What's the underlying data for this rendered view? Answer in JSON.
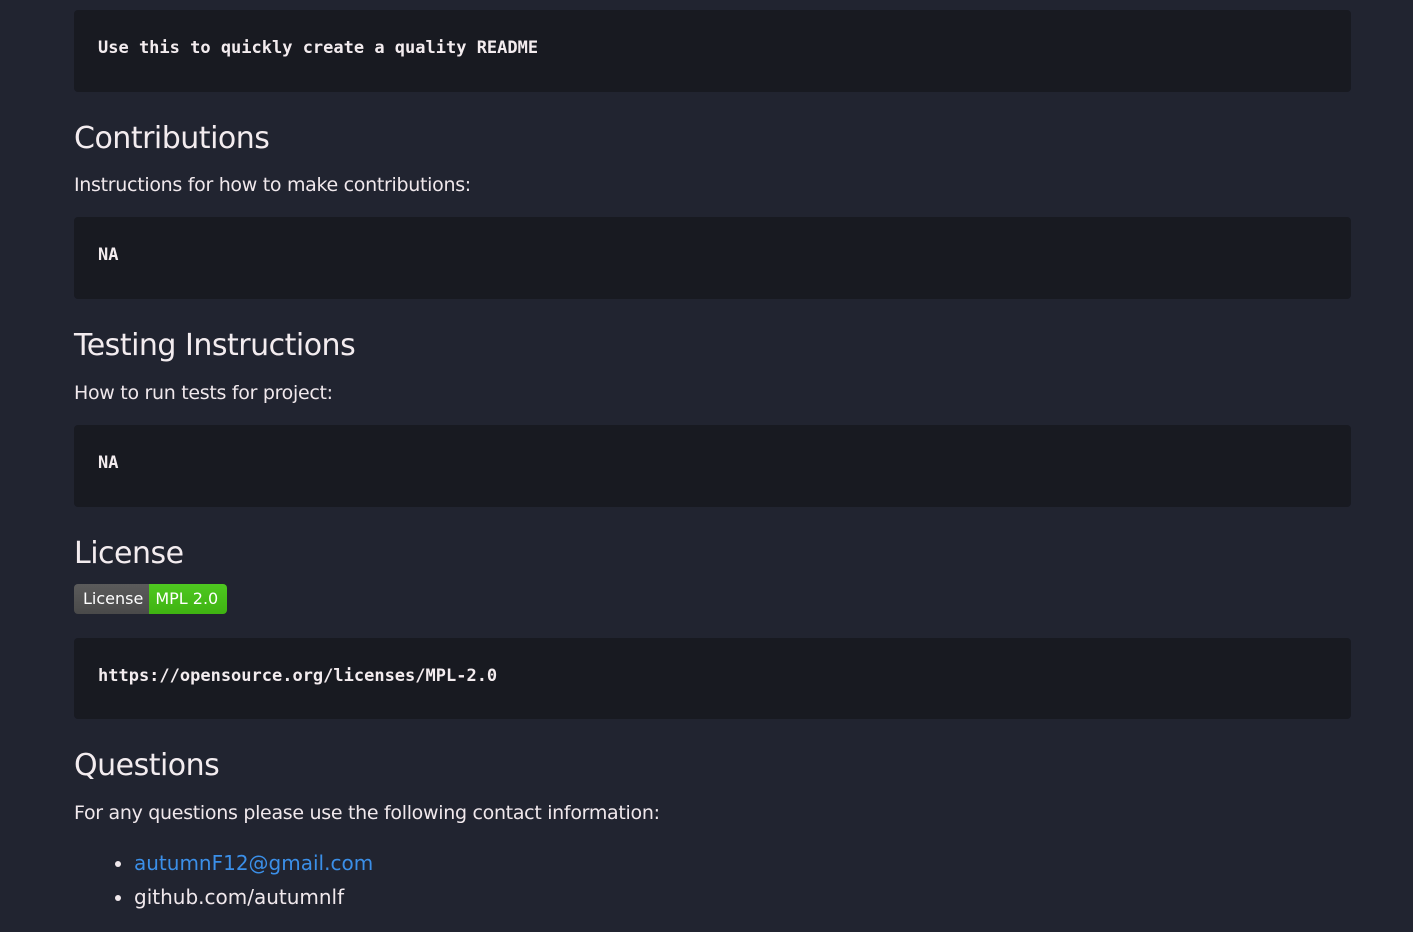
{
  "usage": {
    "code": "Use this to quickly create a quality README"
  },
  "contributions": {
    "heading": "Contributions",
    "text": "Instructions for how to make contributions:",
    "code": "NA"
  },
  "testing": {
    "heading": "Testing Instructions",
    "text": "How to run tests for project:",
    "code": "NA"
  },
  "license": {
    "heading": "License",
    "badge_label": "License",
    "badge_value": "MPL 2.0",
    "badge_color": "#44bb16",
    "code": "https://opensource.org/licenses/MPL-2.0"
  },
  "questions": {
    "heading": "Questions",
    "text": "For any questions please use the following contact information:",
    "items": [
      "autumnF12@gmail.com",
      "github.com/autumnlf"
    ],
    "link_color": "#3b8fe8"
  }
}
